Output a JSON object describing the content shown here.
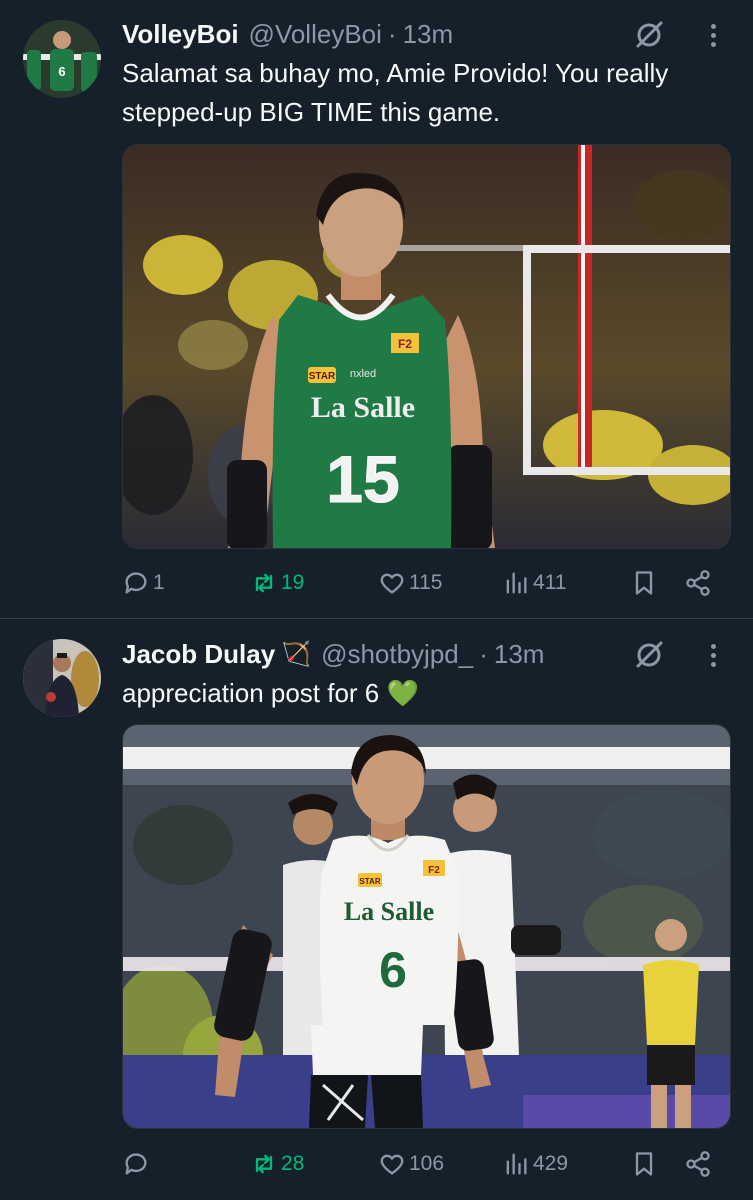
{
  "tweets": [
    {
      "display_name": "VolleyBoi",
      "handle": "@VolleyBoi",
      "separator": "·",
      "time": "13m",
      "text": "Salamat sa buhay mo, Amie Provido! You really stepped-up BIG TIME this game.",
      "media": {
        "jersey_team": "La Salle",
        "jersey_number": "15",
        "sponsor_1": "F2",
        "sponsor_2": "STAR",
        "sponsor_3": "nxled",
        "colors": {
          "jersey": "#1f7a45",
          "crowd": "#d9c33a"
        }
      },
      "stats": {
        "replies": "1",
        "retweets": "19",
        "likes": "115",
        "views": "411"
      }
    },
    {
      "display_name": "Jacob Dulay",
      "name_emoji": "🏹",
      "handle": "@shotbyjpd_",
      "separator": "·",
      "time": "13m",
      "text": "appreciation post for 6 💚",
      "media": {
        "jersey_team": "La Salle",
        "jersey_number": "6",
        "sponsor_1": "F2",
        "sponsor_2": "STAR",
        "colors": {
          "jersey": "#f4f4f2",
          "opponent": "#e8d23b"
        }
      },
      "stats": {
        "replies": "",
        "retweets": "28",
        "likes": "106",
        "views": "429"
      }
    }
  ],
  "icons": [
    "grok-icon",
    "more-icon",
    "reply-icon",
    "retweet-icon",
    "like-icon",
    "views-icon",
    "bookmark-icon",
    "share-icon"
  ],
  "theme": {
    "background": "#15202b",
    "muted": "#8b98a5",
    "retweet_green": "#00ba7c"
  }
}
